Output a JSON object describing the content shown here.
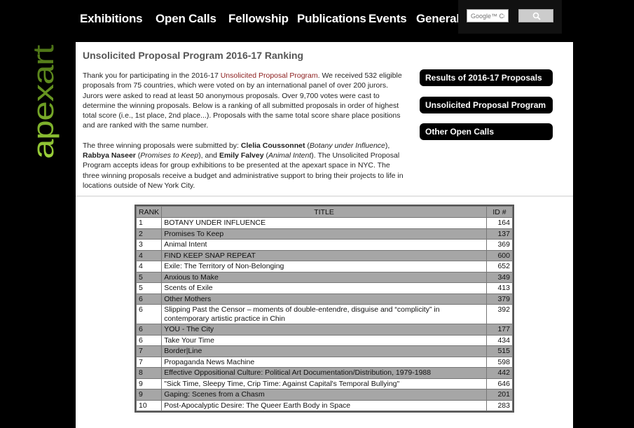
{
  "nav": {
    "items": [
      "Exhibitions",
      "Open Calls",
      "Fellowship",
      "Publications",
      "Events",
      "General"
    ],
    "search_placeholder": "Google™ Cu"
  },
  "logo": {
    "text": "apexart"
  },
  "page": {
    "title": "Unsolicited Proposal Program 2016-17 Ranking",
    "p1_a": "Thank you for participating in the 2016-17 ",
    "p1_link": "Unsolicited Proposal Program",
    "p1_b": ". We received 532 eligible proposals from 75 countries, which were voted on by an international panel of over 200 jurors. Jurors were asked to read at least 50 anonymous proposals. Over 9,700 votes were cast to determine the winning proposals. Below is a ranking of all submitted proposals in order of highest total score (i.e., 1st place, 2nd place...). Proposals with the same total score share place positions and are ranked with the same number.",
    "p2_a": "The three winning proposals were submitted by: ",
    "w1_name": "Clelia Coussonnet",
    "w1_title": "Botany under Influence",
    "w2_name": "Rabbya Naseer",
    "w2_title": "Promises to Keep",
    "w3_name": "Emily Falvey",
    "w3_title": "Animal Intent",
    "p2_b": ". The Unsolicited Proposal Program accepts ideas for group exhibitions to be presented at the apexart space in NYC. The three winning proposals receive a budget and administrative support to bring their projects to life in locations outside of New York City."
  },
  "side_buttons": [
    "Results of 2016-17 Proposals",
    "Unsolicited Proposal Program",
    "Other Open Calls"
  ],
  "table": {
    "headers": [
      "RANK",
      "TITLE",
      "ID #"
    ],
    "rows": [
      {
        "rank": "1",
        "title": "BOTANY UNDER INFLUENCE",
        "id": "164"
      },
      {
        "rank": "2",
        "title": "Promises To Keep",
        "id": "137"
      },
      {
        "rank": "3",
        "title": "Animal Intent",
        "id": "369"
      },
      {
        "rank": "4",
        "title": "FIND KEEP SNAP REPEAT",
        "id": "600"
      },
      {
        "rank": "4",
        "title": "Exile: The Territory of Non-Belonging",
        "id": "652"
      },
      {
        "rank": "5",
        "title": "Anxious to Make",
        "id": "349"
      },
      {
        "rank": "5",
        "title": "Scents of Exile",
        "id": "413"
      },
      {
        "rank": "6",
        "title": "Other Mothers",
        "id": "379"
      },
      {
        "rank": "6",
        "title": "Slipping Past the Censor – moments of double-entendre, disguise and “complicity” in contemporary artistic practice in Chin",
        "id": "392"
      },
      {
        "rank": "6",
        "title": "YOU - The City",
        "id": "177"
      },
      {
        "rank": "6",
        "title": "Take Your Time",
        "id": "434"
      },
      {
        "rank": "7",
        "title": "Border|Line",
        "id": "515"
      },
      {
        "rank": "7",
        "title": "Propaganda News Machine",
        "id": "598"
      },
      {
        "rank": "8",
        "title": "Effective Oppositional Culture: Political Art Documentation/Distribution, 1979-1988",
        "id": "442"
      },
      {
        "rank": "9",
        "title": "\"Sick Time, Sleepy Time, Crip Time: Against Capital's Temporal Bullying\"",
        "id": "646"
      },
      {
        "rank": "9",
        "title": "Gaping: Scenes from a Chasm",
        "id": "201"
      },
      {
        "rank": "10",
        "title": "Post-Apocalyptic Desire: The Queer Earth Body in Space",
        "id": "283"
      }
    ]
  }
}
